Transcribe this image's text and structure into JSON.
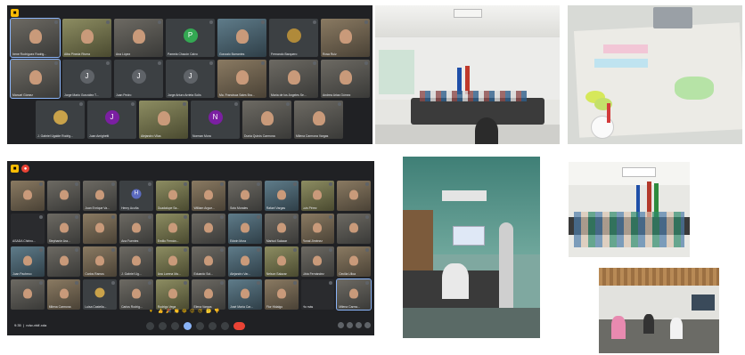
{
  "call1": {
    "rows": [
      [
        {
          "name": "Irene Rodríguez Rodrig...",
          "kind": "cam",
          "highlight": true
        },
        {
          "name": "Alba Pineda Rivera",
          "kind": "cam4"
        },
        {
          "name": "Ana López",
          "kind": "cam"
        },
        {
          "name": "Pamela Chacón Calvo",
          "kind": "avatar",
          "letter": "P",
          "color": "#34a853"
        },
        {
          "name": "Gonzalo Barrantes",
          "kind": "cam3"
        },
        {
          "name": "Fernando Barquero",
          "kind": "avatar",
          "letter": "",
          "color": "#b08a3a"
        },
        {
          "name": "Rosa Ruiz",
          "kind": "cam2"
        }
      ],
      [
        {
          "name": "Manuel Gómez",
          "kind": "cam",
          "highlight": true
        },
        {
          "name": "Jorge Mario González T...",
          "kind": "avatar",
          "letter": "J",
          "color": "#5f6368"
        },
        {
          "name": "Juan Pedro",
          "kind": "avatar",
          "letter": "J",
          "color": "#5f6368"
        },
        {
          "name": "Jorge Arturo Arrieta Solís",
          "kind": "avatar",
          "letter": "J",
          "color": "#5f6368"
        },
        {
          "name": "Ma. Francisca Sales Bra...",
          "kind": "cam2"
        },
        {
          "name": "María de los Ángeles Se...",
          "kind": "cam"
        },
        {
          "name": "Andrea Arias Gómez",
          "kind": "cam"
        }
      ],
      [
        {
          "name": "J. Gabriel Ugalde Rodrig...",
          "kind": "avatar",
          "letter": "",
          "color": "#c9a24a"
        },
        {
          "name": "Juan Amighetti",
          "kind": "avatar",
          "letter": "J",
          "color": "#7b1fa2"
        },
        {
          "name": "Alejandro Vilas",
          "kind": "cam4"
        },
        {
          "name": "Norman Mora",
          "kind": "avatar",
          "letter": "N",
          "color": "#7b1fa2"
        },
        {
          "name": "Dunia Quirós Carmona",
          "kind": "cam"
        },
        {
          "name": "Milena Carmona Vargas",
          "kind": "cam"
        }
      ]
    ]
  },
  "call2": {
    "tiles": [
      {
        "name": "",
        "kind": "cam2"
      },
      {
        "name": "",
        "kind": "cam"
      },
      {
        "name": "Juan Enrique Va...",
        "kind": "cam"
      },
      {
        "name": "Henry Acuña",
        "kind": "avatar",
        "letter": "H",
        "color": "#5c6bc0"
      },
      {
        "name": "Guadalupe Sa...",
        "kind": "cam4"
      },
      {
        "name": "William Argue...",
        "kind": "cam2"
      },
      {
        "name": "Soto Morales",
        "kind": "cam"
      },
      {
        "name": "Rafael Vargas",
        "kind": "cam3"
      },
      {
        "name": "Luis Pérez",
        "kind": "cam4"
      },
      {
        "name": "",
        "kind": "cam2"
      },
      {
        "name": "ASADA Chirino...",
        "kind": "dark"
      },
      {
        "name": "Stephanie Ara...",
        "kind": "cam"
      },
      {
        "name": "",
        "kind": "cam2"
      },
      {
        "name": "Ana Fuentes",
        "kind": "cam"
      },
      {
        "name": "Emilio Fernán...",
        "kind": "cam4"
      },
      {
        "name": "",
        "kind": "cam"
      },
      {
        "name": "Edwin Mora",
        "kind": "cam3"
      },
      {
        "name": "Marisol Salazar",
        "kind": "cam"
      },
      {
        "name": "Ronal Jiménez",
        "kind": "cam2"
      },
      {
        "name": "",
        "kind": "cam"
      },
      {
        "name": "Juan Pacheco",
        "kind": "cam3"
      },
      {
        "name": "",
        "kind": "cam"
      },
      {
        "name": "Carlos Ramos",
        "kind": "cam2"
      },
      {
        "name": "J. Gabriel Ug...",
        "kind": "cam"
      },
      {
        "name": "Ana Lorena Ma...",
        "kind": "cam4"
      },
      {
        "name": "Eduardo Sol...",
        "kind": "cam"
      },
      {
        "name": "Alejandro Var...",
        "kind": "cam3"
      },
      {
        "name": "Nelson Salazar",
        "kind": "cam4"
      },
      {
        "name": "Libia Fernández",
        "kind": "cam"
      },
      {
        "name": "Cecilia Ulloa",
        "kind": "cam2"
      },
      {
        "name": "",
        "kind": "cam"
      },
      {
        "name": "Milena Carmona",
        "kind": "cam2"
      },
      {
        "name": "Luisa Castella...",
        "kind": "avatar",
        "letter": "",
        "color": "#c9a24a"
      },
      {
        "name": "Carlos Rodríg...",
        "kind": "cam"
      },
      {
        "name": "Rodrigo Vega",
        "kind": "cam4"
      },
      {
        "name": "Elena Vargas",
        "kind": "cam"
      },
      {
        "name": "José María Car...",
        "kind": "cam3"
      },
      {
        "name": "Flor Hidalgo",
        "kind": "cam2"
      },
      {
        "name": "Ho más",
        "kind": "dark"
      },
      {
        "name": "Milena Carmo...",
        "kind": "cam",
        "highlight": true
      }
    ],
    "time": "9:35",
    "meeting_code": "ndw-vtdf-xda",
    "emojis": [
      "♥",
      "👍",
      "🎉",
      "👏",
      "😂",
      "😮",
      "😢",
      "🤔",
      "👎"
    ]
  }
}
